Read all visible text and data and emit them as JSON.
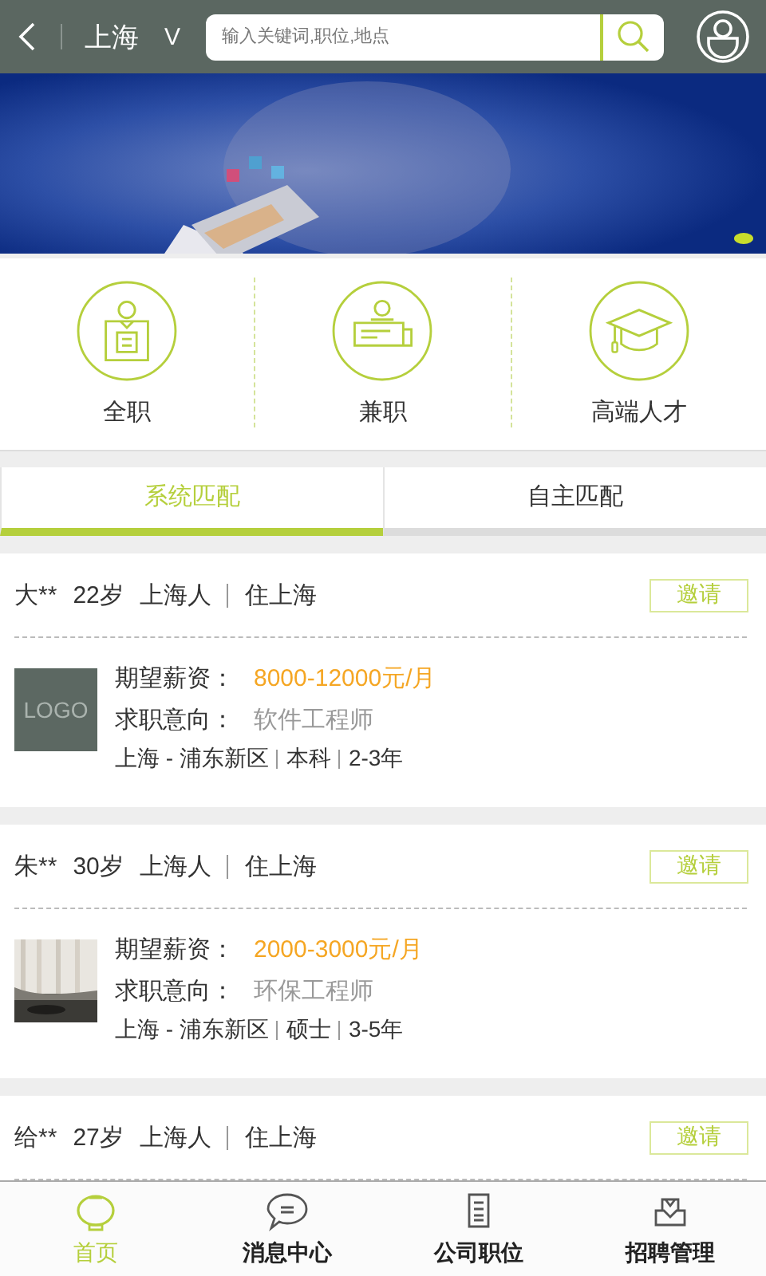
{
  "header": {
    "city": "上海",
    "city_caret": "V",
    "search": {
      "placeholder": "输入关键词,职位,地点"
    }
  },
  "banner": {
    "kind": "picture",
    "pages": [
      {
        "selected": true
      }
    ]
  },
  "categories": [
    {
      "label": "全职",
      "kind": "fulltime"
    },
    {
      "label": "兼职",
      "kind": "parttime"
    },
    {
      "label": "高端人才",
      "kind": "talent"
    }
  ],
  "tabs": [
    {
      "label": "系统匹配",
      "selected": true
    },
    {
      "label": "自主匹配",
      "selected": false
    }
  ],
  "candidates": [
    {
      "name": "大**",
      "age": "22岁",
      "origin": "上海人",
      "residence": "住上海",
      "action": "邀请",
      "avatar": {
        "kind": "placeholder",
        "text": "LOGO"
      },
      "details": {
        "salary_label": "期望薪资：",
        "salary": "8000-12000元/月",
        "intent_label": "求职意向：",
        "intent": "软件工程师",
        "location": "上海 - 浦东新区",
        "education": "本科",
        "experience": "2-3年"
      }
    },
    {
      "name": "朱**",
      "age": "30岁",
      "origin": "上海人",
      "residence": "住上海",
      "action": "邀请",
      "details": {
        "salary_label": "期望薪资：",
        "salary": "2000-3000元/月",
        "intent_label": "求职意向：",
        "intent": "环保工程师",
        "location": "上海 - 浦东新区",
        "education": "硕士",
        "experience": "3-5年"
      }
    },
    {
      "name": "给**",
      "age": "27岁",
      "origin": "上海人",
      "residence": "住上海",
      "action": "邀请"
    }
  ],
  "bottom_nav": [
    {
      "label": "首页",
      "kind": "home",
      "selected": true
    },
    {
      "label": "消息中心",
      "kind": "message",
      "selected": false
    },
    {
      "label": "公司职位",
      "kind": "jobs",
      "selected": false
    },
    {
      "label": "招聘管理",
      "kind": "manage",
      "selected": false
    }
  ]
}
